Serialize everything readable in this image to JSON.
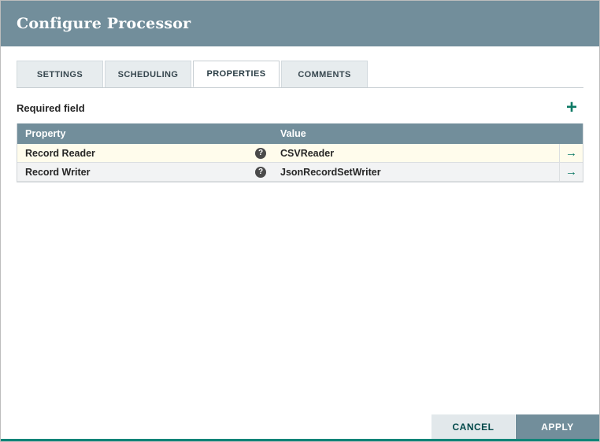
{
  "dialog": {
    "title": "Configure Processor"
  },
  "tabs": [
    {
      "label": "SETTINGS",
      "active": false
    },
    {
      "label": "SCHEDULING",
      "active": false
    },
    {
      "label": "PROPERTIES",
      "active": true
    },
    {
      "label": "COMMENTS",
      "active": false
    }
  ],
  "properties_tab": {
    "required_field_label": "Required field",
    "table": {
      "columns": [
        "Property",
        "Value"
      ],
      "rows": [
        {
          "property": "Record Reader",
          "value": "CSVReader",
          "required": true
        },
        {
          "property": "Record Writer",
          "value": "JsonRecordSetWriter",
          "required": false
        }
      ]
    }
  },
  "icons": {
    "add": "+",
    "help": "?",
    "goto": "→"
  },
  "footer": {
    "cancel_label": "CANCEL",
    "apply_label": "APPLY"
  },
  "colors": {
    "header_bg": "#728e9b",
    "accent_teal": "#0e7a65",
    "row_highlight": "#fffcec",
    "bottom_strip": "#118478"
  }
}
